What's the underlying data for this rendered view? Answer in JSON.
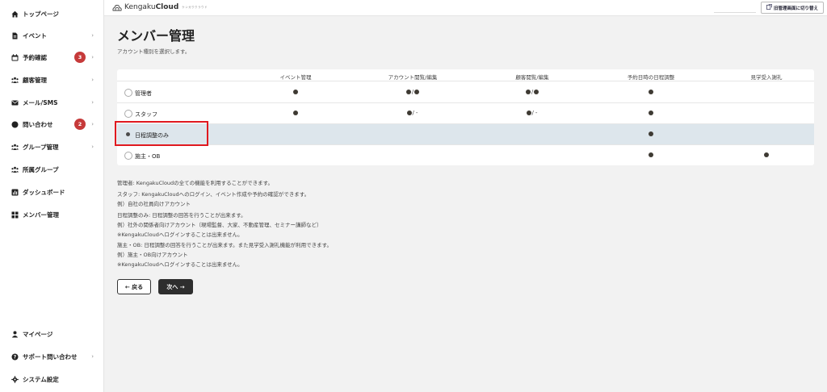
{
  "sidebar": {
    "items": [
      {
        "label": "トップページ",
        "icon": "home-icon",
        "chevron": ""
      },
      {
        "label": "イベント",
        "icon": "document-icon",
        "chevron": "›"
      },
      {
        "label": "予約確認",
        "icon": "calendar-icon",
        "chevron": "›",
        "badge": "3"
      },
      {
        "label": "顧客管理",
        "icon": "people-icon",
        "chevron": "›"
      },
      {
        "label": "メール/SMS",
        "icon": "mail-icon",
        "chevron": "›"
      },
      {
        "label": "問い合わせ",
        "icon": "chat-icon",
        "chevron": "›",
        "badge": "2"
      },
      {
        "label": "グループ管理",
        "icon": "group-icon",
        "chevron": "›"
      },
      {
        "label": "所属グループ",
        "icon": "group-icon",
        "chevron": ""
      },
      {
        "label": "ダッシュボード",
        "icon": "chart-icon",
        "chevron": ""
      },
      {
        "label": "メンバー管理",
        "icon": "grid-icon",
        "chevron": ""
      }
    ],
    "bottom_items": [
      {
        "label": "マイページ",
        "icon": "user-icon",
        "chevron": ""
      },
      {
        "label": "サポート問い合わせ",
        "icon": "help-icon",
        "chevron": "›"
      },
      {
        "label": "システム設定",
        "icon": "gear-icon",
        "chevron": ""
      }
    ],
    "badge_color": "#c63a3a"
  },
  "topbar": {
    "logo_plain": "Kengaku",
    "logo_bold": "Cloud",
    "logo_sub": "ケンガククラウド",
    "switch_label": "旧管理画面に切り替え"
  },
  "page": {
    "title": "メンバー管理",
    "subtitle": "アカウント種別を選択します。"
  },
  "table": {
    "headers": [
      "イベント管理",
      "アカウント閲覧/編集",
      "顧客閲覧/編集",
      "予約日時の日程調整",
      "見学受入謝礼"
    ],
    "rows": [
      {
        "label": "管理者",
        "selected": false,
        "cells": [
          [
            "dot"
          ],
          [
            "dot",
            "/",
            "dot"
          ],
          [
            "dot",
            "/",
            "dot"
          ],
          [
            "dot"
          ],
          []
        ]
      },
      {
        "label": "スタッフ",
        "selected": false,
        "cells": [
          [
            "dot"
          ],
          [
            "dot",
            "/",
            "-"
          ],
          [
            "dot",
            "/",
            "-"
          ],
          [
            "dot"
          ],
          []
        ]
      },
      {
        "label": "日程調整のみ",
        "selected": true,
        "cells": [
          [],
          [],
          [],
          [
            "dot"
          ],
          []
        ]
      },
      {
        "label": "施主・OB",
        "selected": false,
        "cells": [
          [],
          [],
          [],
          [
            "dot"
          ],
          [
            "dot"
          ]
        ]
      }
    ],
    "selected_row_color": "#dde6ec",
    "highlight_color": "#e0191f"
  },
  "descriptions": [
    "管理者: KengakuCloudの全ての機能を利用することができます。",
    "スタッフ: KengakuCloudへのログイン、イベント作成や予約の確認ができます。",
    "例）自社の社員向けアカウント",
    "日程調整のみ: 日程調整の回答を行うことが出来ます。",
    "例）社外の関係者向けアカウント（現場監督、大家、不動産管理、セミナー講師など）",
    "※KengakuCloudへログインすることは出来ません。",
    "施主・OB: 日程調整の回答を行うことが出来ます。また見学受入謝礼機能が利用できます。",
    "例）施主・OB向けアカウント",
    "※KengakuCloudへログインすることは出来ません。"
  ],
  "buttons": {
    "back_label": "← 戻る",
    "next_label": "次へ →"
  }
}
